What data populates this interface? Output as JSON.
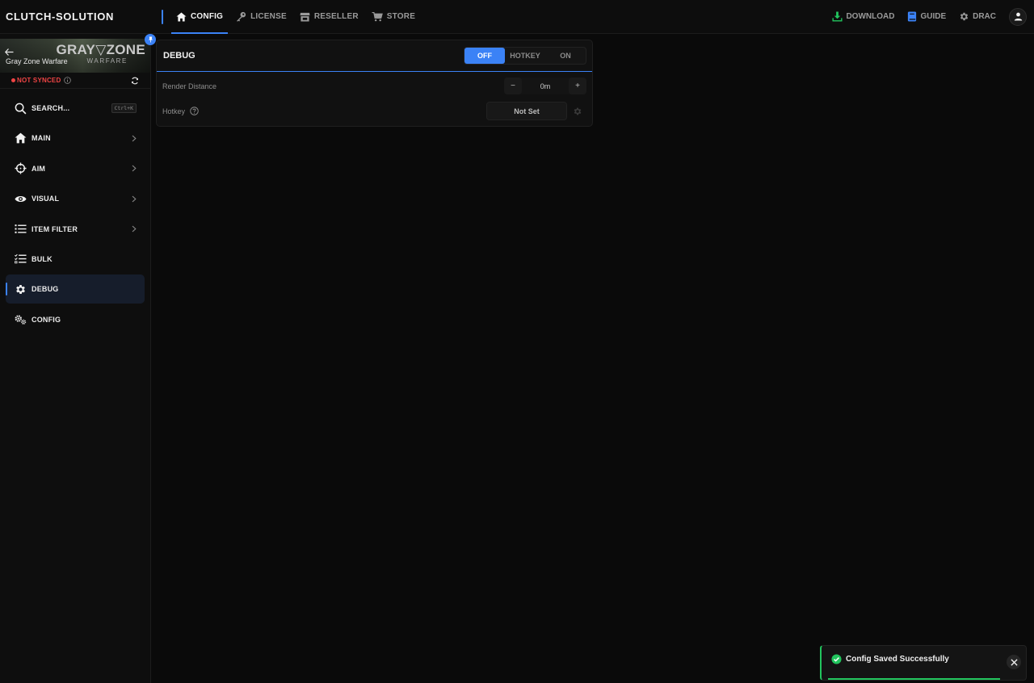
{
  "topbar": {
    "brand": "CLUTCH-SOLUTION",
    "tabs": [
      {
        "label": "CONFIG",
        "icon": "home-icon",
        "active": true
      },
      {
        "label": "LICENSE",
        "icon": "key-icon",
        "active": false
      },
      {
        "label": "RESELLER",
        "icon": "store-icon",
        "active": false
      },
      {
        "label": "STORE",
        "icon": "cart-icon",
        "active": false
      }
    ],
    "right": {
      "download": "DOWNLOAD",
      "guide": "GUIDE",
      "user": "DRAC"
    }
  },
  "sidebar": {
    "game": {
      "name": "Gray Zone Warfare",
      "logo_line1": "GRAY▽ZONE",
      "logo_line2": "WARFARE"
    },
    "sync_status": "NOT SYNCED",
    "items": [
      {
        "label": "SEARCH...",
        "icon": "search-icon",
        "shortcut": "Ctrl+K"
      },
      {
        "label": "MAIN",
        "icon": "home-icon",
        "has_chevron": true
      },
      {
        "label": "AIM",
        "icon": "crosshair-icon",
        "has_chevron": true
      },
      {
        "label": "VISUAL",
        "icon": "eye-icon",
        "has_chevron": true
      },
      {
        "label": "ITEM FILTER",
        "icon": "list-icon",
        "has_chevron": true
      },
      {
        "label": "BULK",
        "icon": "checklist-icon",
        "has_chevron": false
      },
      {
        "label": "DEBUG",
        "icon": "gear-icon",
        "has_chevron": false,
        "active": true
      },
      {
        "label": "CONFIG",
        "icon": "gears-icon",
        "has_chevron": false
      }
    ]
  },
  "debug_card": {
    "title": "DEBUG",
    "mode_options": [
      "OFF",
      "HOTKEY",
      "ON"
    ],
    "selected_mode": "OFF",
    "render_distance": {
      "label": "Render Distance",
      "value": "0m",
      "minus": "−",
      "plus": "+"
    },
    "hotkey": {
      "label": "Hotkey",
      "value": "Not Set"
    }
  },
  "toast": {
    "message": "Config Saved Successfully",
    "close": "X"
  },
  "colors": {
    "accent": "#3b82f6",
    "success": "#22c55e",
    "danger": "#ef4444"
  }
}
